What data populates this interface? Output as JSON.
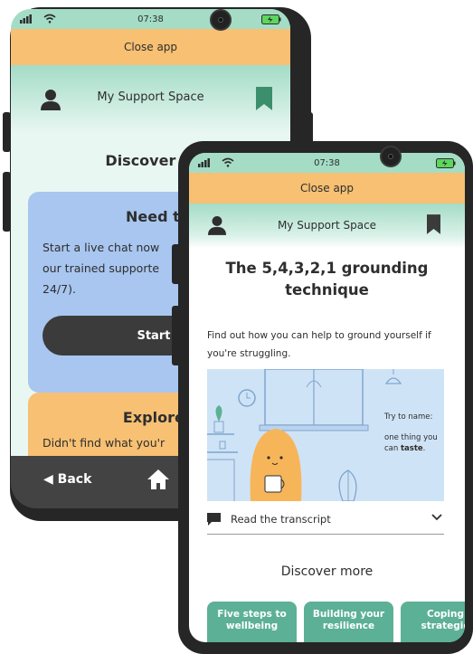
{
  "back_phone": {
    "status": {
      "time": "07:38"
    },
    "close_label": "Close app",
    "header_title": "My Support Space",
    "discover_title": "Discover m",
    "chat_card": {
      "title": "Need to t",
      "body_lines": [
        "Start a live chat now",
        "our trained supporte",
        "24/7)."
      ],
      "button": "Start a live"
    },
    "explore_card": {
      "title": "Explore m",
      "body": "Didn't find what you'r"
    },
    "nav": {
      "back": "Back"
    }
  },
  "front_phone": {
    "status": {
      "time": "07:38"
    },
    "close_label": "Close app",
    "header_title": "My Support Space",
    "page_title_line1": "The 5,4,3,2,1 grounding",
    "page_title_line2": "technique",
    "intro": "Find out how you can help to ground yourself if you're struggling.",
    "illustration": {
      "try_name": "Try to name:",
      "line1": "one thing you",
      "line2_prefix": "can ",
      "line2_bold": "taste",
      "line2_suffix": "."
    },
    "transcript_label": "Read the transcript",
    "discover_title": "Discover more",
    "tiles": [
      {
        "line1": "Five steps to",
        "line2": "wellbeing"
      },
      {
        "line1": "Building your",
        "line2": "resilience"
      },
      {
        "line1": "Coping",
        "line2": "strategie"
      }
    ]
  },
  "colors": {
    "mint": "#a4dcc6",
    "orange": "#f7c073",
    "blue_card": "#a8c6ef",
    "green_tile": "#5cb095",
    "dark": "#3b3b3b"
  }
}
